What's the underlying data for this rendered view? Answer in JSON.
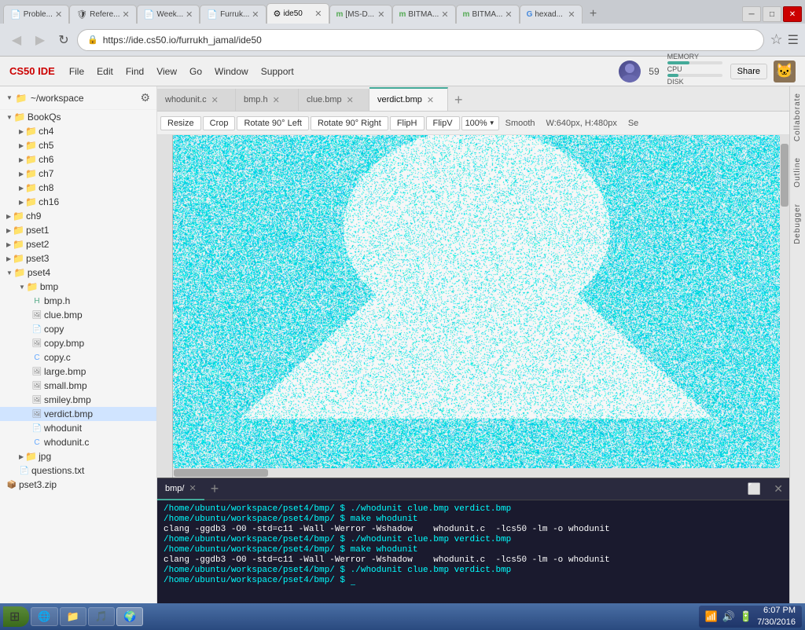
{
  "browser": {
    "tabs": [
      {
        "id": "tab1",
        "title": "Proble...",
        "favicon": "📄",
        "active": false,
        "closable": true
      },
      {
        "id": "tab2",
        "title": "Refere...",
        "favicon": "🛡",
        "active": false,
        "closable": true
      },
      {
        "id": "tab3",
        "title": "Week...",
        "favicon": "📄",
        "active": false,
        "closable": true
      },
      {
        "id": "tab4",
        "title": "Furruk...",
        "favicon": "📄",
        "active": false,
        "closable": true
      },
      {
        "id": "tab5",
        "title": "ide50",
        "favicon": "⚙",
        "active": true,
        "closable": true
      },
      {
        "id": "tab6",
        "title": "[MS-D...",
        "favicon": "m",
        "active": false,
        "closable": true
      },
      {
        "id": "tab7",
        "title": "BITMA...",
        "favicon": "m",
        "active": false,
        "closable": true
      },
      {
        "id": "tab8",
        "title": "BITMA...",
        "favicon": "m",
        "active": false,
        "closable": true
      },
      {
        "id": "tab9",
        "title": "hexad...",
        "favicon": "G",
        "active": false,
        "closable": true
      }
    ],
    "url": "https://ide.cs50.io/furrukh_jamal/ide50",
    "back_disabled": true,
    "forward_disabled": true
  },
  "app": {
    "title": "CS50 IDE",
    "menus": [
      "File",
      "Edit",
      "Find",
      "View",
      "Go",
      "Window",
      "Support"
    ],
    "user_count": "59",
    "share_label": "Share",
    "memory_label": "MEMORY",
    "cpu_label": "CPU",
    "disk_label": "DISK"
  },
  "sidebar": {
    "title": "~/workspace",
    "items": [
      {
        "label": "BookQs",
        "type": "folder",
        "depth": 1,
        "expanded": true
      },
      {
        "label": "ch4",
        "type": "folder",
        "depth": 2,
        "expanded": false
      },
      {
        "label": "ch5",
        "type": "folder",
        "depth": 2,
        "expanded": false
      },
      {
        "label": "ch6",
        "type": "folder",
        "depth": 2,
        "expanded": false
      },
      {
        "label": "ch7",
        "type": "folder",
        "depth": 2,
        "expanded": false
      },
      {
        "label": "ch8",
        "type": "folder",
        "depth": 2,
        "expanded": false
      },
      {
        "label": "ch16",
        "type": "folder",
        "depth": 2,
        "expanded": false
      },
      {
        "label": "ch9",
        "type": "folder",
        "depth": 1,
        "expanded": false
      },
      {
        "label": "pset1",
        "type": "folder",
        "depth": 1,
        "expanded": false
      },
      {
        "label": "pset2",
        "type": "folder",
        "depth": 1,
        "expanded": false
      },
      {
        "label": "pset3",
        "type": "folder",
        "depth": 1,
        "expanded": false
      },
      {
        "label": "pset4",
        "type": "folder",
        "depth": 1,
        "expanded": true
      },
      {
        "label": "bmp",
        "type": "folder",
        "depth": 2,
        "expanded": true
      },
      {
        "label": "bmp.h",
        "type": "file-h",
        "depth": 3
      },
      {
        "label": "clue.bmp",
        "type": "file-bmp",
        "depth": 3
      },
      {
        "label": "copy",
        "type": "file",
        "depth": 3
      },
      {
        "label": "copy.bmp",
        "type": "file-bmp",
        "depth": 3
      },
      {
        "label": "copy.c",
        "type": "file-c",
        "depth": 3
      },
      {
        "label": "large.bmp",
        "type": "file-bmp",
        "depth": 3
      },
      {
        "label": "small.bmp",
        "type": "file-bmp",
        "depth": 3
      },
      {
        "label": "smiley.bmp",
        "type": "file-bmp",
        "depth": 3
      },
      {
        "label": "verdict.bmp",
        "type": "file-bmp",
        "depth": 3,
        "selected": true
      },
      {
        "label": "whodunit",
        "type": "file",
        "depth": 3
      },
      {
        "label": "whodunit.c",
        "type": "file-c",
        "depth": 3
      },
      {
        "label": "jpg",
        "type": "folder",
        "depth": 2,
        "expanded": false
      },
      {
        "label": "questions.txt",
        "type": "file-txt",
        "depth": 2
      },
      {
        "label": "pset3.zip",
        "type": "file-zip",
        "depth": 1
      }
    ]
  },
  "editor": {
    "tabs": [
      {
        "label": "whodunit.c",
        "active": false,
        "closable": true
      },
      {
        "label": "bmp.h",
        "active": false,
        "closable": true
      },
      {
        "label": "clue.bmp",
        "active": false,
        "closable": true
      },
      {
        "label": "verdict.bmp",
        "active": true,
        "closable": true
      }
    ],
    "image_toolbar": {
      "resize": "Resize",
      "crop": "Crop",
      "rotate_left": "Rotate 90° Left",
      "rotate_right": "Rotate 90° Right",
      "flip_h": "FlipH",
      "flip_v": "FlipV",
      "zoom": "100%",
      "smooth": "Smooth",
      "dimensions": "W:640px, H:480px",
      "settings": "Se"
    }
  },
  "terminal": {
    "tabs": [
      {
        "label": "bmp/",
        "active": true,
        "closable": true
      }
    ],
    "lines": [
      {
        "text": "/home/ubuntu/workspace/pset4/bmp/ $ ./whodunit clue.bmp verdict.bmp",
        "type": "prompt"
      },
      {
        "text": "/home/ubuntu/workspace/pset4/bmp/ $ make whodunit",
        "type": "prompt"
      },
      {
        "text": "clang -ggdb3 -O0 -std=c11 -Wall -Werror -Wshadow    whodunit.c  -lcs50 -lm -o whodunit",
        "type": "output"
      },
      {
        "text": "/home/ubuntu/workspace/pset4/bmp/ $ ./whodunit clue.bmp verdict.bmp",
        "type": "prompt"
      },
      {
        "text": "/home/ubuntu/workspace/pset4/bmp/ $ make whodunit",
        "type": "prompt"
      },
      {
        "text": "clang -ggdb3 -O0 -std=c11 -Wall -Werror -Wshadow    whodunit.c  -lcs50 -lm -o whodunit",
        "type": "output"
      },
      {
        "text": "/home/ubuntu/workspace/pset4/bmp/ $ ./whodunit clue.bmp verdict.bmp",
        "type": "prompt"
      },
      {
        "text": "/home/ubuntu/workspace/pset4/bmp/ $ ",
        "type": "prompt"
      }
    ]
  },
  "right_panels": [
    "Collaborate",
    "Outline",
    "Debugger"
  ],
  "taskbar": {
    "start_icon": "⊞",
    "buttons": [
      {
        "label": "🌐",
        "title": "Internet Explorer"
      },
      {
        "label": "📁",
        "title": "File Explorer"
      },
      {
        "label": "🎵",
        "title": "Media"
      },
      {
        "label": "🌍",
        "title": "Chrome"
      }
    ],
    "tray": {
      "icons": [
        "🔊",
        "🔋",
        "📶"
      ],
      "time": "6:07 PM",
      "date": "7/30/2016"
    }
  }
}
